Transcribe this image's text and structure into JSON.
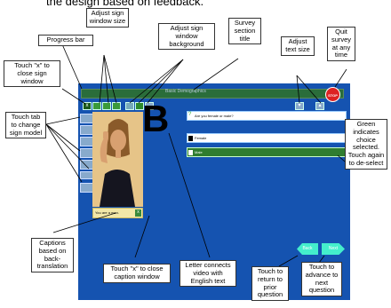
{
  "page_top_text": "the design based on feedback.",
  "app": {
    "section_title": "Basic Demographics",
    "stop_label": "STOP",
    "question": "Are you female or male?",
    "answer_1": "Female",
    "answer_2": "Male",
    "letter": "B",
    "caption": "You are a man.",
    "close_glyph": "x",
    "back_label": "Back",
    "next_label": "Next",
    "tabs": [
      {
        "label": ""
      },
      {
        "label": ""
      },
      {
        "label": ""
      },
      {
        "label": ""
      },
      {
        "label": ""
      },
      {
        "label": ""
      },
      {
        "label": ""
      }
    ]
  },
  "annotations": {
    "progress_bar": "Progress bar",
    "close_sign_window": "Touch \"x\" to close sign window",
    "adjust_sign_size": "Adjust sign window size",
    "adjust_sign_bg": "Adjust sign window background",
    "survey_section_title": "Survey section title",
    "adjust_text_size": "Adjust text size",
    "quit_survey": "Quit survey at any time",
    "touch_tab": "Touch tab to change sign model",
    "green_indicates": "Green indicates choice selected. Touch again to de-select",
    "captions": "Captions based on back-translation",
    "close_caption": "Touch \"x\" to close caption window",
    "letter_connects": "Letter connects video with English text",
    "return_prior": "Touch to return to prior question",
    "advance_next": "Touch to advance to next question"
  },
  "colors": {
    "screen_bg": "#1553b0",
    "selected_green": "#2f7d2f",
    "stop_red": "#d22222",
    "nav_cyan": "#44eecc",
    "progress_green": "#2a6d3a"
  }
}
